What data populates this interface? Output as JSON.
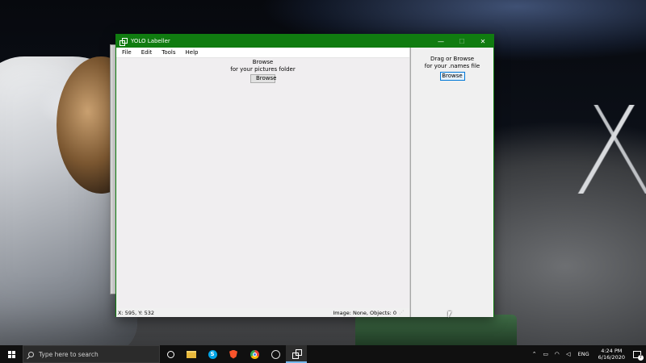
{
  "window": {
    "title": "YOLO Labeller",
    "controls": {
      "minimize": "—",
      "maximize": "☐",
      "close": "✕"
    }
  },
  "menu": [
    "File",
    "Edit",
    "Tools",
    "Help"
  ],
  "left_panel": {
    "line1": "Browse",
    "line2": "for your pictures folder",
    "button": "Browse"
  },
  "right_panel": {
    "line1": "Drag or Browse",
    "line2": "for your .names file",
    "button": "Browse"
  },
  "status": {
    "coords": "X: 595, Y: 532",
    "info": "Image: None, Objects: 0"
  },
  "taskbar": {
    "search_placeholder": "Type here to search",
    "apps": [
      "cortana-icon",
      "file-explorer-icon",
      "skype-icon",
      "brave-icon",
      "chrome-icon",
      "obs-icon",
      "yolo-labeller-icon"
    ],
    "skype_letter": "S",
    "language": "ENG",
    "time": "4:24 PM",
    "date": "6/16/2020",
    "notification_count": "7"
  },
  "colors": {
    "titlebar": "#107c10",
    "taskbar": "#101010",
    "window_bg": "#f0f0f0"
  }
}
